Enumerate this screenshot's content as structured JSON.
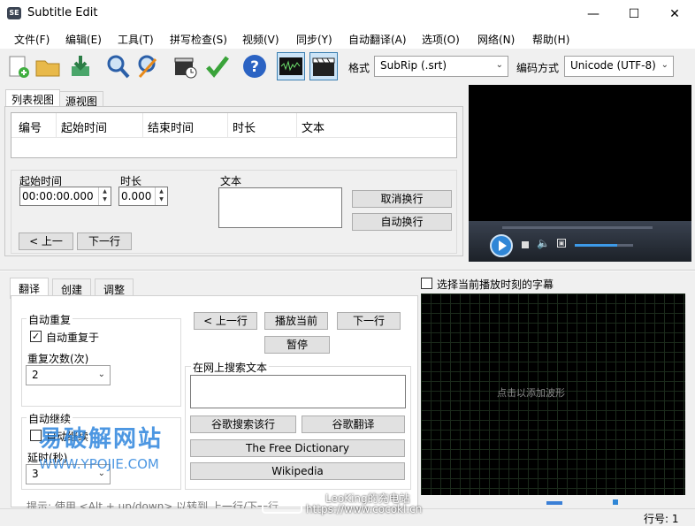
{
  "window": {
    "title": "Subtitle Edit",
    "icon_text": "SE"
  },
  "menu": [
    "文件(F)",
    "编辑(E)",
    "工具(T)",
    "拼写检查(S)",
    "视频(V)",
    "同步(Y)",
    "自动翻译(A)",
    "选项(O)",
    "网络(N)",
    "帮助(H)"
  ],
  "toolbar": {
    "format_label": "格式",
    "format_value": "SubRip (.srt)",
    "encoding_label": "编码方式",
    "encoding_value": "Unicode (UTF-8)"
  },
  "view_tabs": {
    "list": "列表视图",
    "source": "源视图"
  },
  "table": {
    "headers": {
      "no": "编号",
      "start": "起始时间",
      "end": "结束时间",
      "duration": "时长",
      "text": "文本"
    }
  },
  "editor": {
    "start_label": "起始时间",
    "start_value": "00:00:00.000",
    "duration_label": "时长",
    "duration_value": "0.000",
    "text_label": "文本",
    "unbreak": "取消换行",
    "autobreak": "自动换行",
    "prev": "< 上一",
    "next": "下一行"
  },
  "bottom_tabs": {
    "translate": "翻译",
    "create": "创建",
    "adjust": "调整"
  },
  "translate": {
    "auto_repeat_group": "自动重复",
    "auto_repeat_on": "自动重复于",
    "repeat_count_label": "重复次数(次)",
    "repeat_count_value": "2",
    "auto_continue_group": "自动继续",
    "auto_continue_on": "自动继续",
    "delay_label": "延时(秒)",
    "delay_value": "3",
    "prev": "< 上一行",
    "play_current": "播放当前",
    "next": "下一行",
    "pause": "暂停",
    "search_group": "在网上搜索文本",
    "google_search": "谷歌搜索该行",
    "google_translate": "谷歌翻译",
    "free_dictionary": "The Free Dictionary",
    "wikipedia": "Wikipedia",
    "tip": "提示: 使用 <Alt + up/down> 以转到 上一行/下一行"
  },
  "waveform": {
    "select_current": "选择当前播放时刻的字幕",
    "add_hint": "点击以添加波形"
  },
  "status": {
    "line": "行号: 1"
  },
  "watermark": {
    "site_cn": "易破解网站",
    "site_url": "WWW.YPOJIE.COM",
    "credit_1": "LeoKing的充电站",
    "credit_2": "https://www.cocokl.cn"
  }
}
